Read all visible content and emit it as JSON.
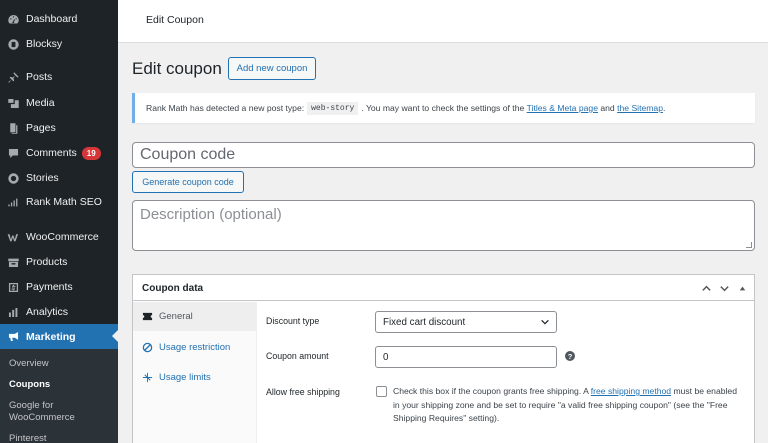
{
  "sidebar": {
    "items": [
      {
        "label": "Dashboard",
        "icon": "dashboard-icon"
      },
      {
        "label": "Blocksy",
        "icon": "blocksy-icon"
      },
      {
        "label": "Posts",
        "icon": "pin-icon"
      },
      {
        "label": "Media",
        "icon": "media-icon"
      },
      {
        "label": "Pages",
        "icon": "pages-icon"
      },
      {
        "label": "Comments",
        "icon": "comment-icon",
        "badge": "19"
      },
      {
        "label": "Stories",
        "icon": "stories-icon"
      },
      {
        "label": "Rank Math SEO",
        "icon": "chart-icon"
      },
      {
        "label": "WooCommerce",
        "icon": "woocommerce-icon"
      },
      {
        "label": "Products",
        "icon": "archive-icon"
      },
      {
        "label": "Payments",
        "icon": "dollar-icon"
      },
      {
        "label": "Analytics",
        "icon": "bar-chart-icon"
      },
      {
        "label": "Marketing",
        "icon": "megaphone-icon",
        "active": true
      }
    ],
    "submenu": [
      {
        "label": "Overview"
      },
      {
        "label": "Coupons",
        "current": true
      },
      {
        "label": "Google for WooCommerce"
      },
      {
        "label": "Pinterest"
      }
    ]
  },
  "header": {
    "title": "Edit Coupon"
  },
  "main": {
    "page_title": "Edit coupon",
    "add_new_label": "Add new coupon",
    "notice": {
      "text_before": "Rank Math has detected a new post type:",
      "code": "web-story",
      "text_middle": ". You may want to check the settings of the",
      "link1": "Titles & Meta page",
      "text_and": "and",
      "link2": "the Sitemap",
      "text_end": "."
    },
    "coupon_code_placeholder": "Coupon code",
    "generate_label": "Generate coupon code",
    "description_placeholder": "Description (optional)"
  },
  "coupon_data": {
    "title": "Coupon data",
    "tabs": [
      {
        "label": "General",
        "icon": "ticket-icon",
        "active": true
      },
      {
        "label": "Usage restriction",
        "icon": "block-icon"
      },
      {
        "label": "Usage limits",
        "icon": "limits-icon"
      }
    ],
    "fields": {
      "discount_type_label": "Discount type",
      "discount_type_value": "Fixed cart discount",
      "amount_label": "Coupon amount",
      "amount_value": "0",
      "help_glyph": "?",
      "free_shipping_label": "Allow free shipping",
      "free_shipping_text1": "Check this box if the coupon grants free shipping. A",
      "free_shipping_link": "free shipping method",
      "free_shipping_text2": "must be enabled in your shipping zone and be set to require \"a valid free shipping coupon\" (see the \"Free Shipping Requires\" setting)."
    }
  },
  "colors": {
    "sidebar_bg": "#1d2327",
    "accent": "#2271b1",
    "badge": "#d63638",
    "page_bg": "#f0f0f1"
  }
}
